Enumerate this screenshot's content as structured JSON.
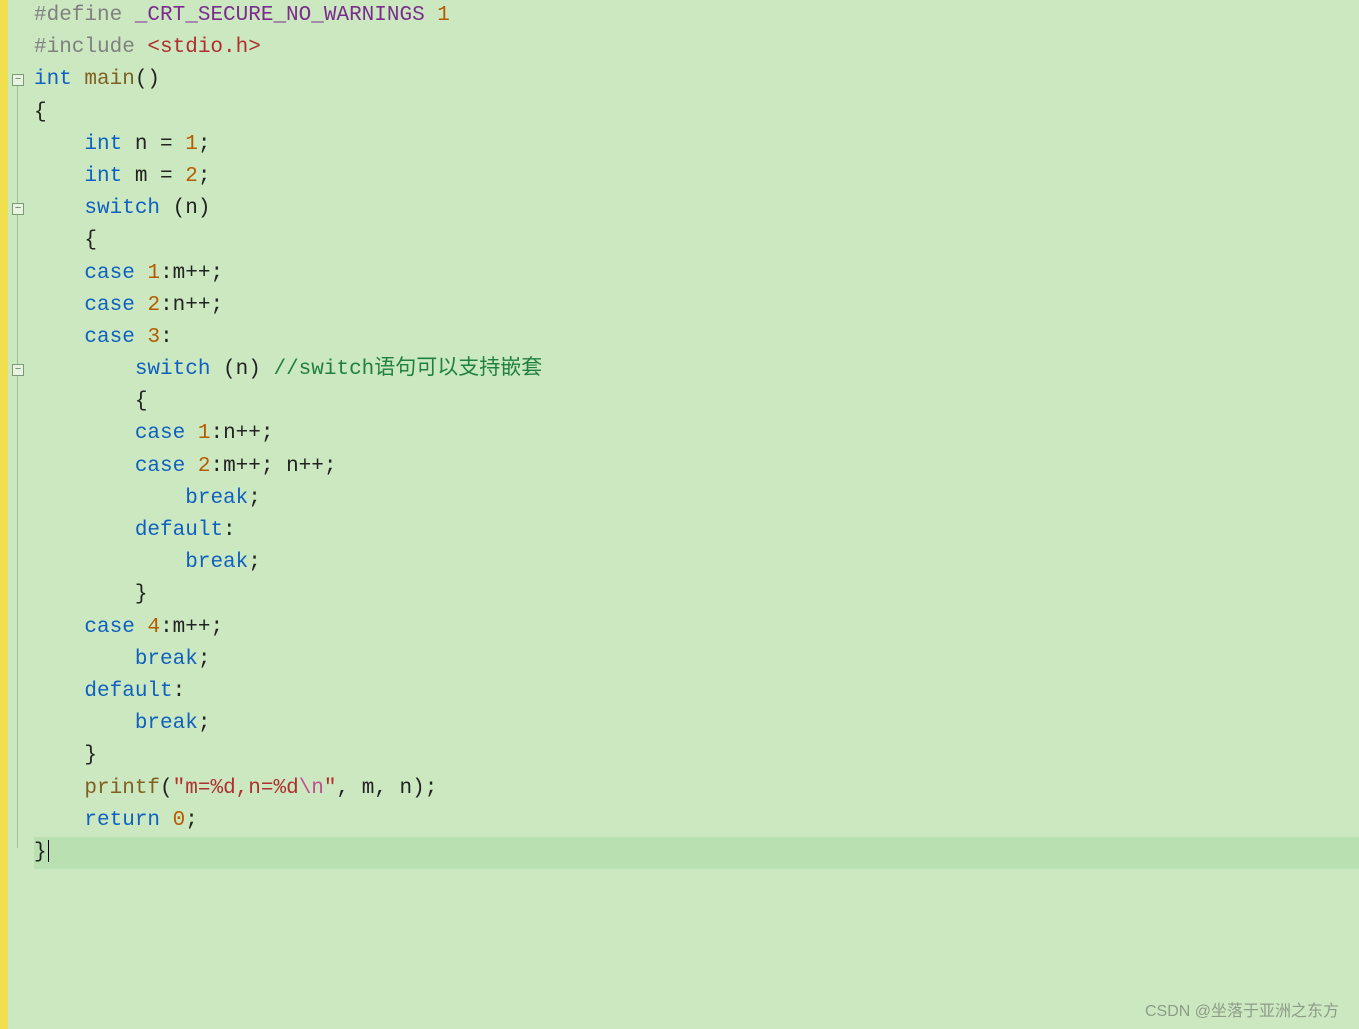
{
  "code": {
    "l1_define": "#define ",
    "l1_macro": "_CRT_SECURE_NO_WARNINGS ",
    "l1_num": "1",
    "l2_include": "#include ",
    "l2_header": "<stdio.h>",
    "l3_int": "int",
    "l3_main": " main",
    "l3_paren": "()",
    "l4_brace": "{",
    "l5_int": "int",
    "l5_rest": " n = ",
    "l5_num": "1",
    "l5_semi": ";",
    "l6_int": "int",
    "l6_rest": " m = ",
    "l6_num": "2",
    "l6_semi": ";",
    "l7_switch": "switch",
    "l7_rest": " (n)",
    "l8_brace": "{",
    "l9_case": "case",
    "l9_sp": " ",
    "l9_num": "1",
    "l9_rest": ":m++;",
    "l10_case": "case",
    "l10_sp": " ",
    "l10_num": "2",
    "l10_rest": ":n++;",
    "l11_case": "case",
    "l11_sp": " ",
    "l11_num": "3",
    "l11_rest": ":",
    "l12_switch": "switch",
    "l12_rest": " (n) ",
    "l12_comment": "//switch语句可以支持嵌套",
    "l13_brace": "{",
    "l14_case": "case",
    "l14_sp": " ",
    "l14_num": "1",
    "l14_rest": ":n++;",
    "l15_case": "case",
    "l15_sp": " ",
    "l15_num": "2",
    "l15_rest": ":m++; n++;",
    "l16_break": "break",
    "l16_semi": ";",
    "l17_default": "default",
    "l17_rest": ":",
    "l18_break": "break",
    "l18_semi": ";",
    "l19_brace": "}",
    "l20_case": "case",
    "l20_sp": " ",
    "l20_num": "4",
    "l20_rest": ":m++;",
    "l21_break": "break",
    "l21_semi": ";",
    "l22_default": "default",
    "l22_rest": ":",
    "l23_break": "break",
    "l23_semi": ";",
    "l24_brace": "}",
    "l25_fn": "printf",
    "l25_open": "(",
    "l25_str1": "\"m=%d,n=%d",
    "l25_esc": "\\n",
    "l25_str2": "\"",
    "l25_rest": ", m, n);",
    "l26_return": "return",
    "l26_sp": " ",
    "l26_num": "0",
    "l26_semi": ";",
    "l27_brace": "}"
  },
  "gutter": {
    "minus": "−"
  },
  "watermark": "CSDN @坐落于亚洲之东方"
}
